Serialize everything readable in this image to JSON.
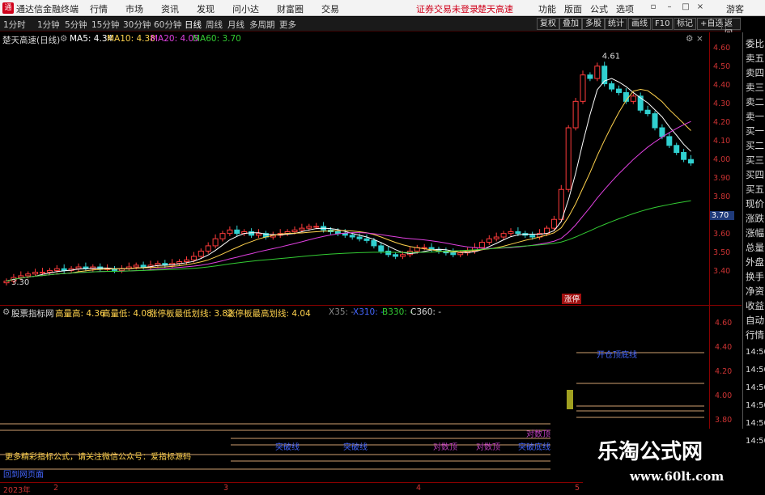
{
  "titlebar": {
    "app_name": "通达信金融终端",
    "menus": [
      "行情",
      "市场",
      "资讯",
      "发现",
      "问小达",
      "财富圈",
      "交易"
    ],
    "warning": "证券交易未登录",
    "stock_link": "楚天高速",
    "right_menus": [
      "功能",
      "版面",
      "公式",
      "选项"
    ],
    "user": "游客"
  },
  "toolbar": {
    "timeframes": [
      "1分时",
      "1分钟",
      "5分钟",
      "15分钟",
      "30分钟",
      "60分钟",
      "日线",
      "周线",
      "月线",
      "多周期",
      "更多"
    ],
    "active_timeframe": "日线",
    "right_buttons": [
      "复权",
      "叠加",
      "多股",
      "统计",
      "画线",
      "F10",
      "标记",
      "+自选",
      "返回"
    ]
  },
  "main_chart": {
    "stock_title": "楚天高速(日线)",
    "ma5": "MA5: 4.34",
    "ma10": "MA10: 4.38",
    "ma20": "MA20: 4.05",
    "ma60": "MA60: 3.70",
    "high_label": "4.61",
    "low_label": "3.30",
    "event_badge": "涨停",
    "current_price_tag": "3.70"
  },
  "price_axis": [
    "4.60",
    "4.50",
    "4.40",
    "4.30",
    "4.20",
    "4.10",
    "4.00",
    "3.90",
    "3.80",
    "3.70",
    "3.60",
    "3.50",
    "3.40"
  ],
  "right_side_panel": [
    "委比",
    "卖五",
    "卖四",
    "卖三",
    "卖二",
    "卖一",
    "买一",
    "买二",
    "买三",
    "买四",
    "买五",
    "现价",
    "涨跌",
    "涨幅",
    "总量",
    "外盘",
    "换手",
    "净资",
    "收益",
    "自动",
    "行情",
    "14:50",
    "14:50",
    "14:50",
    "14:50",
    "14:50",
    "14:50"
  ],
  "indicator": {
    "name": "股票指标网",
    "line1": "高量高: 4.36",
    "line2": "高量低: 4.08",
    "line3": "涨停板最低划线: 3.82",
    "line4": "涨停板最高划线: 4.04",
    "x35": "X35: -",
    "x310": "X310: -",
    "b330": "B330: -",
    "c360": "C360: -",
    "labels": [
      "突破线",
      "突破线",
      "对数顶",
      "对数顶",
      "对数顶",
      "突破底线",
      "对数顶"
    ],
    "marker_label": "开仓顶底线",
    "footer_promo": "更多精彩指标公式，请关注微信公众号：爱指标源码",
    "footer_link": "回到网页面"
  },
  "indicator_axis": [
    "4.60",
    "4.40",
    "4.20",
    "4.00",
    "3.80"
  ],
  "time_axis": [
    "2023年",
    "2",
    "3",
    "4",
    "5"
  ],
  "watermark": {
    "title": "乐淘公式网",
    "url": "www.60lt.com"
  },
  "chart_data": {
    "type": "candlestick",
    "price_range": [
      3.3,
      4.65
    ],
    "ma_values": {
      "MA5": 4.34,
      "MA10": 4.38,
      "MA20": 4.05,
      "MA60": 3.7
    },
    "high": 4.61,
    "low": 3.3,
    "closes": [
      3.33,
      3.35,
      3.36,
      3.37,
      3.38,
      3.38,
      3.39,
      3.4,
      3.39,
      3.4,
      3.41,
      3.4,
      3.41,
      3.4,
      3.4,
      3.39,
      3.4,
      3.41,
      3.42,
      3.41,
      3.42,
      3.43,
      3.42,
      3.43,
      3.44,
      3.45,
      3.47,
      3.5,
      3.53,
      3.57,
      3.6,
      3.62,
      3.6,
      3.61,
      3.59,
      3.6,
      3.58,
      3.59,
      3.6,
      3.61,
      3.62,
      3.63,
      3.64,
      3.64,
      3.62,
      3.61,
      3.6,
      3.59,
      3.58,
      3.57,
      3.56,
      3.53,
      3.5,
      3.48,
      3.47,
      3.48,
      3.5,
      3.52,
      3.52,
      3.51,
      3.5,
      3.49,
      3.48,
      3.49,
      3.5,
      3.52,
      3.55,
      3.57,
      3.58,
      3.6,
      3.61,
      3.6,
      3.59,
      3.58,
      3.6,
      3.63,
      3.68,
      3.85,
      4.2,
      4.35,
      4.5,
      4.48,
      4.55,
      4.45,
      4.42,
      4.4,
      4.35,
      4.38,
      4.3,
      4.28,
      4.2,
      4.15,
      4.1,
      4.06,
      4.02,
      4.0
    ]
  }
}
